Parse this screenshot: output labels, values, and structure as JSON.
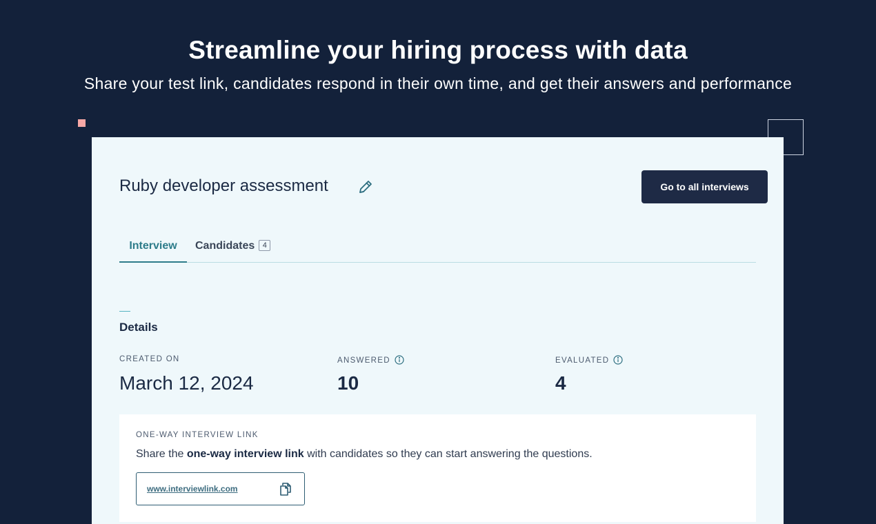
{
  "hero": {
    "title": "Streamline your hiring process with data",
    "subtitle": "Share your test link, candidates respond in their own time, and get their answers and performance"
  },
  "card": {
    "title": "Ruby developer assessment",
    "go_button_label": "Go to all interviews",
    "tabs": [
      {
        "label": "Interview",
        "active": true
      },
      {
        "label": "Candidates",
        "badge": "4",
        "active": false
      }
    ],
    "details": {
      "section_title": "Details",
      "stats": [
        {
          "label": "CREATED ON",
          "value": "March 12, 2024",
          "info_icon": false
        },
        {
          "label": "ANSWERED",
          "value": "10",
          "info_icon": true
        },
        {
          "label": "EVALUATED",
          "value": "4",
          "info_icon": true
        }
      ]
    },
    "link_section": {
      "label": "ONE-WAY INTERVIEW LINK",
      "desc_prefix": "Share the ",
      "desc_bold": "one-way interview link",
      "desc_suffix": " with candidates so they can start answering the questions.",
      "url": "www.interviewlink.com"
    }
  },
  "icons": {
    "edit": "pencil-icon",
    "info": "info-icon",
    "copy": "copy-icon"
  },
  "colors": {
    "background": "#13213a",
    "card": "#eff8fb",
    "accent": "#2d7c8a",
    "button": "#1e2a45",
    "deco_square": "#f7a8a6"
  }
}
